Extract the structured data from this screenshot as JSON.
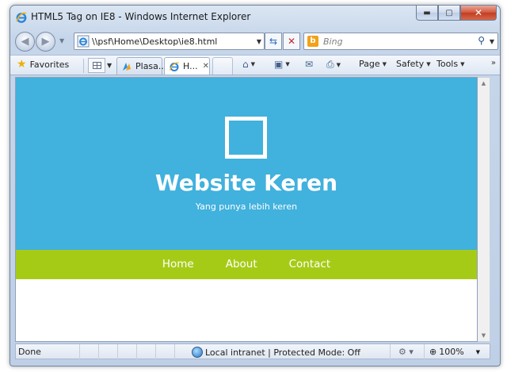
{
  "window": {
    "title": "HTML5 Tag on IE8 - Windows Internet Explorer",
    "minimize_icon": "minimize-icon",
    "maximize_icon": "maximize-icon",
    "close_icon": "close-icon"
  },
  "navigation": {
    "address": "\\\\psf\\Home\\Desktop\\ie8.html",
    "search_placeholder": "Bing",
    "search_engine_icon": "b"
  },
  "favorites_bar": {
    "favorites_label": "Favorites",
    "tabs": [
      {
        "label": "Plasa...",
        "active": false
      },
      {
        "label": "H...",
        "active": true
      }
    ],
    "commands": {
      "page": "Page",
      "safety": "Safety",
      "tools": "Tools"
    }
  },
  "site": {
    "title": "Website Keren",
    "subtitle": "Yang punya lebih keren",
    "menu": [
      "Home",
      "About",
      "Contact"
    ],
    "colors": {
      "hero": "#41b1dd",
      "menu": "#a6cb17"
    }
  },
  "status": {
    "text": "Done",
    "zone": "Local intranet | Protected Mode: Off",
    "zoom": "100%"
  }
}
